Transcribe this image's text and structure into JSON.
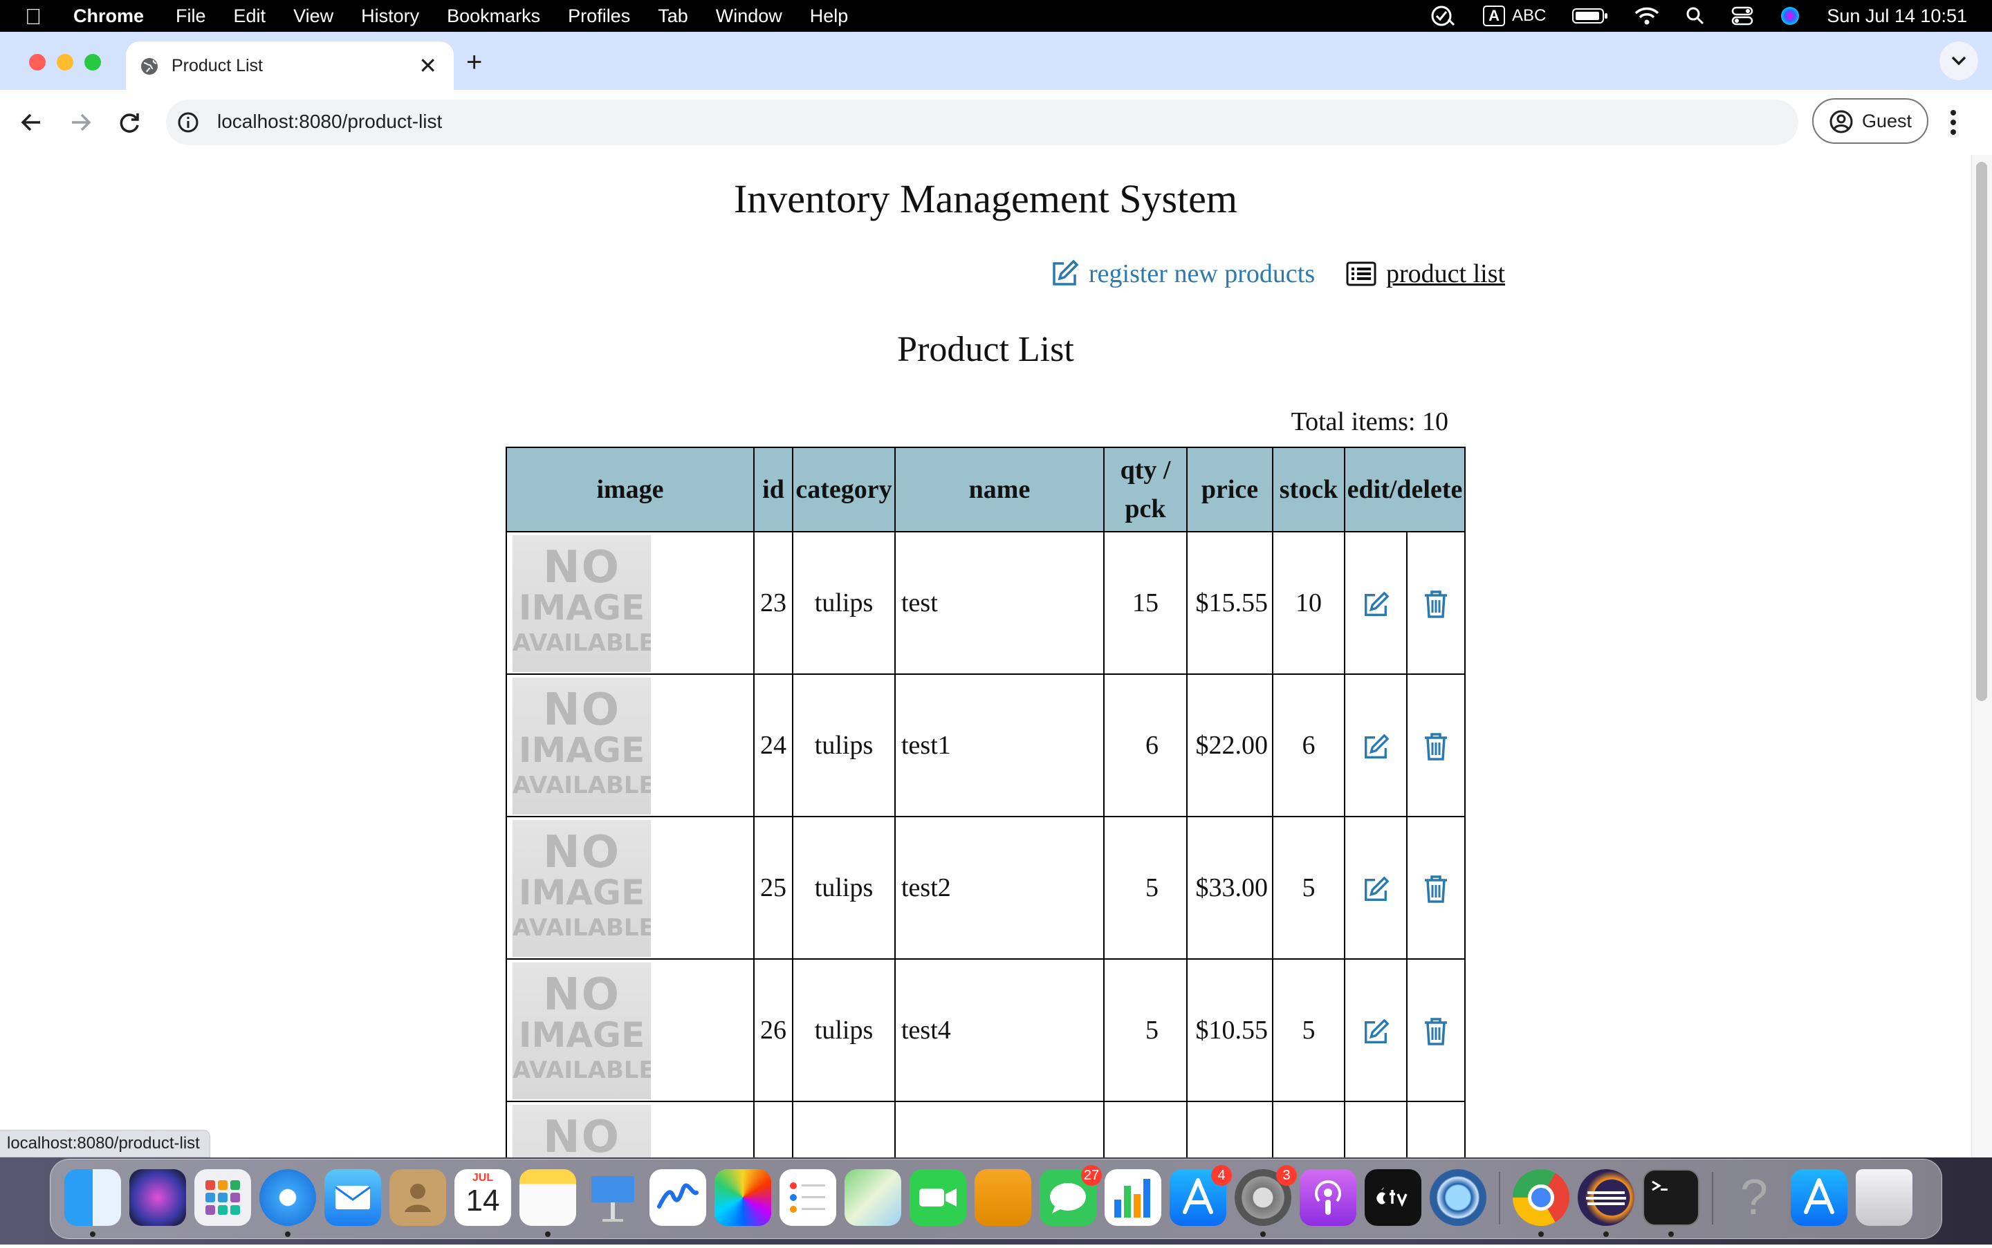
{
  "menubar": {
    "app_name": "Chrome",
    "menus": [
      "File",
      "Edit",
      "View",
      "History",
      "Bookmarks",
      "Profiles",
      "Tab",
      "Window",
      "Help"
    ],
    "input_source": "A",
    "input_label": "ABC",
    "datetime": "Sun Jul 14  10:51"
  },
  "browser": {
    "tab_title": "Product List",
    "url": "localhost:8080/product-list",
    "profile_label": "Guest",
    "status_url": "localhost:8080/product-list"
  },
  "page": {
    "title": "Inventory Management System",
    "nav": {
      "register_label": "register new products",
      "list_label": "product list"
    },
    "list_title": "Product List",
    "total_label": "Total items: 10",
    "table": {
      "headers": [
        "image",
        "id",
        "category",
        "name",
        "qty / pck",
        "price",
        "stock",
        "edit/delete"
      ],
      "placeholder_image": {
        "line1": "NO",
        "line2": "IMAGE",
        "line3": "AVAILABLE"
      },
      "rows": [
        {
          "id": "23",
          "category": "tulips",
          "name": "test",
          "qty": "15",
          "price": "$15.55",
          "stock": "10"
        },
        {
          "id": "24",
          "category": "tulips",
          "name": "test1",
          "qty": "6",
          "price": "$22.00",
          "stock": "6"
        },
        {
          "id": "25",
          "category": "tulips",
          "name": "test2",
          "qty": "5",
          "price": "$33.00",
          "stock": "5"
        },
        {
          "id": "26",
          "category": "tulips",
          "name": "test4",
          "qty": "5",
          "price": "$10.55",
          "stock": "5"
        }
      ]
    }
  },
  "dock": {
    "badges": {
      "messages": "27",
      "appstore": "4",
      "settings": "3"
    },
    "calendar_month": "JUL",
    "calendar_day": "14"
  },
  "colors": {
    "accent": "#2a7ab0",
    "table_header": "#9bc2cc",
    "tabstrip": "#d3e3fd"
  }
}
